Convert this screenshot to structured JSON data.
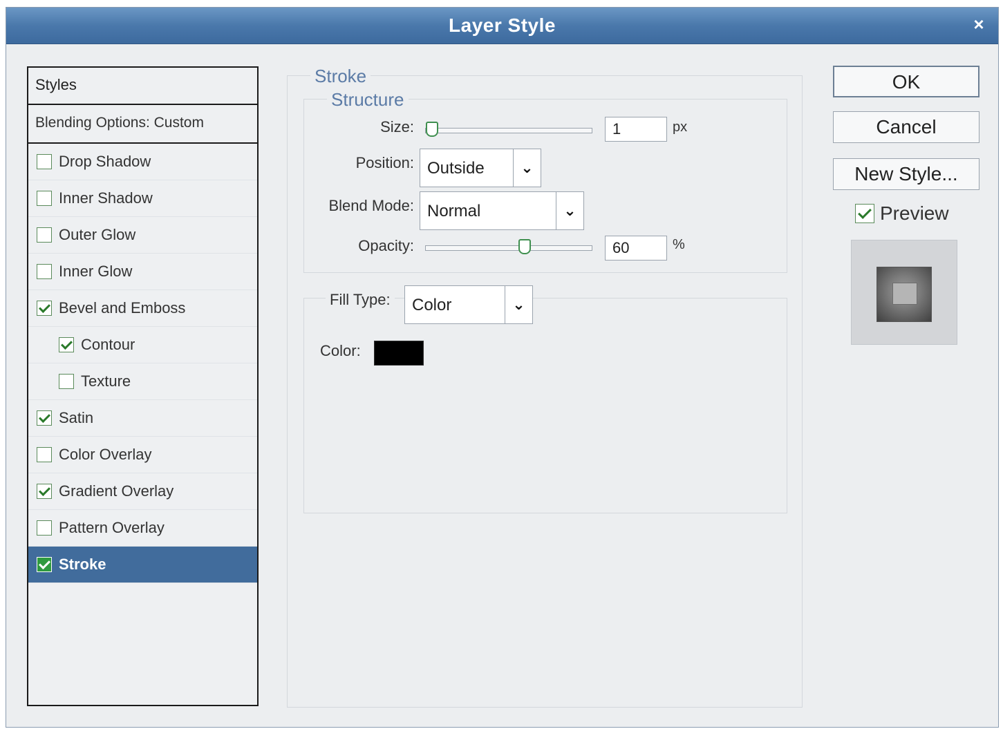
{
  "window": {
    "title": "Layer Style",
    "close_glyph": "×"
  },
  "styles_panel": {
    "header": "Styles",
    "blending_options": "Blending Options: Custom",
    "items": [
      {
        "label": "Drop Shadow",
        "checked": false,
        "indent": false,
        "selected": false
      },
      {
        "label": "Inner Shadow",
        "checked": false,
        "indent": false,
        "selected": false
      },
      {
        "label": "Outer Glow",
        "checked": false,
        "indent": false,
        "selected": false
      },
      {
        "label": "Inner Glow",
        "checked": false,
        "indent": false,
        "selected": false
      },
      {
        "label": "Bevel and Emboss",
        "checked": true,
        "indent": false,
        "selected": false
      },
      {
        "label": "Contour",
        "checked": true,
        "indent": true,
        "selected": false
      },
      {
        "label": "Texture",
        "checked": false,
        "indent": true,
        "selected": false
      },
      {
        "label": "Satin",
        "checked": true,
        "indent": false,
        "selected": false
      },
      {
        "label": "Color Overlay",
        "checked": false,
        "indent": false,
        "selected": false
      },
      {
        "label": "Gradient Overlay",
        "checked": true,
        "indent": false,
        "selected": false
      },
      {
        "label": "Pattern Overlay",
        "checked": false,
        "indent": false,
        "selected": false
      },
      {
        "label": "Stroke",
        "checked": true,
        "indent": false,
        "selected": true
      }
    ]
  },
  "stroke": {
    "group_title": "Stroke",
    "structure": {
      "title": "Structure",
      "size_label": "Size:",
      "size_value": "1",
      "size_unit": "px",
      "size_slider_fraction": 0.0,
      "position_label": "Position:",
      "position_value": "Outside",
      "blend_mode_label": "Blend Mode:",
      "blend_mode_value": "Normal",
      "opacity_label": "Opacity:",
      "opacity_value": "60",
      "opacity_unit": "%",
      "opacity_slider_fraction": 0.6
    },
    "fill": {
      "fill_type_label": "Fill Type:",
      "fill_type_value": "Color",
      "color_label": "Color:",
      "color_value": "#000000"
    }
  },
  "buttons": {
    "ok": "OK",
    "cancel": "Cancel",
    "new_style": "New Style..."
  },
  "preview": {
    "label": "Preview",
    "checked": true
  },
  "icons": {
    "dropdown": "chevron-down-icon",
    "close": "close-icon",
    "slider": "slider-thumb-icon"
  },
  "colors": {
    "titlebar": "#4a78ab",
    "selected_row": "#416c9c",
    "legend_text": "#5b7ba6",
    "check_green": "#2a7a2a"
  }
}
